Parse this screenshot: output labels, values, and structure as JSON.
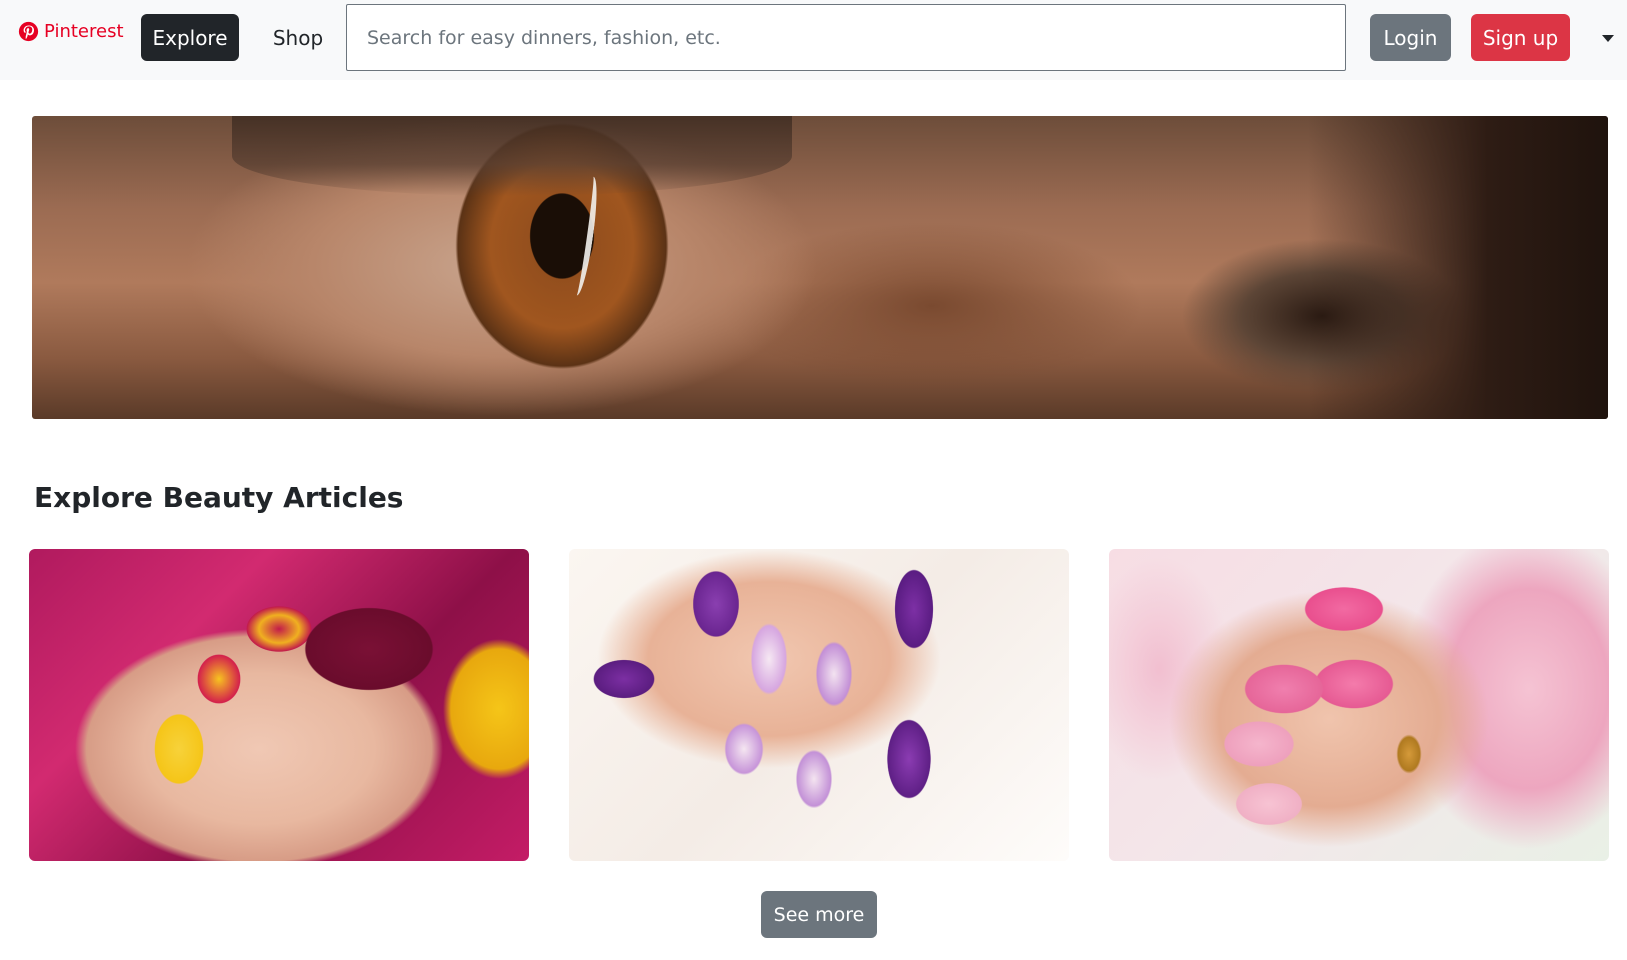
{
  "navbar": {
    "brand_label": "Pinterest",
    "explore_label": "Explore",
    "shop_label": "Shop",
    "search_placeholder": "Search for easy dinners, fashion, etc.",
    "search_value": "",
    "login_label": "Login",
    "signup_label": "Sign up",
    "menu_icon": "caret-down-icon"
  },
  "hero": {
    "image": "eye-close-up"
  },
  "section": {
    "title": "Explore Beauty Articles",
    "cards": [
      {
        "image": "multicolor-nails-flowers"
      },
      {
        "image": "purple-floral-nails"
      },
      {
        "image": "pink-nails-lily"
      }
    ],
    "see_more_label": "See more"
  },
  "colors": {
    "brand": "#e60023",
    "dark_button": "#212529",
    "secondary_button": "#6c757d",
    "danger_button": "#dc3545",
    "navbar_bg": "#f8f9fa"
  }
}
